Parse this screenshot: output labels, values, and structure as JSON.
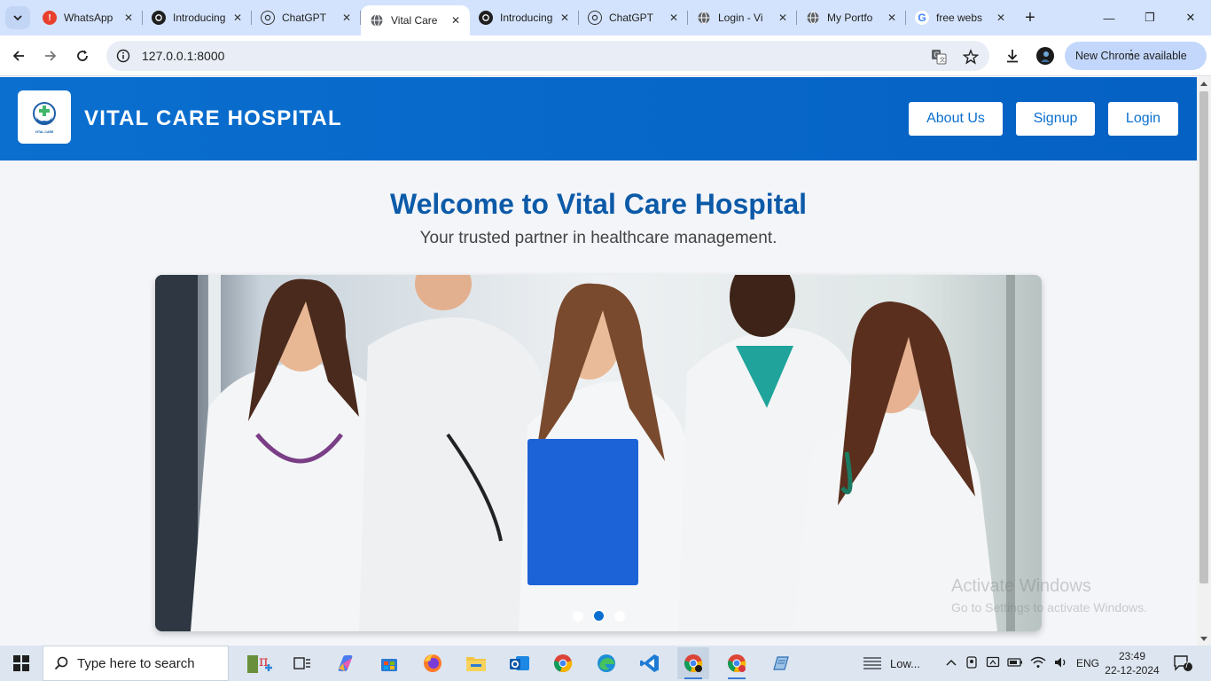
{
  "browser": {
    "tabs": [
      {
        "title": "WhatsApp",
        "icon": "whatsapp-icon",
        "active": false
      },
      {
        "title": "Introducing",
        "icon": "openai-icon",
        "active": false
      },
      {
        "title": "ChatGPT",
        "icon": "openai-icon",
        "active": false
      },
      {
        "title": "Vital Care",
        "icon": "globe-icon",
        "active": true
      },
      {
        "title": "Introducing",
        "icon": "openai-icon",
        "active": false
      },
      {
        "title": "ChatGPT",
        "icon": "openai-icon",
        "active": false
      },
      {
        "title": "Login - Vi",
        "icon": "globe-icon",
        "active": false
      },
      {
        "title": "My Portfo",
        "icon": "globe-icon",
        "active": false
      },
      {
        "title": "free webs",
        "icon": "google-icon",
        "active": false
      }
    ],
    "url": "127.0.0.1:8000",
    "update_label": "New Chrome available"
  },
  "site": {
    "brand": "VITAL CARE HOSPITAL",
    "logo_text": "VITAL CARE",
    "nav": {
      "about": "About Us",
      "signup": "Signup",
      "login": "Login"
    },
    "welcome_title": "Welcome to Vital Care Hospital",
    "tagline": "Your trusted partner in healthcare management.",
    "carousel": {
      "slide_count": 3,
      "active_index": 1
    },
    "colors": {
      "primary": "#0a6fcf",
      "title": "#0c5aa8"
    }
  },
  "watermark": {
    "line1": "Activate Windows",
    "line2": "Go to Settings to activate Windows."
  },
  "taskbar": {
    "search_placeholder": "Type here to search",
    "weather": "Low...",
    "language": "ENG",
    "time": "23:49",
    "date": "22-12-2024",
    "notification_count": "7"
  }
}
